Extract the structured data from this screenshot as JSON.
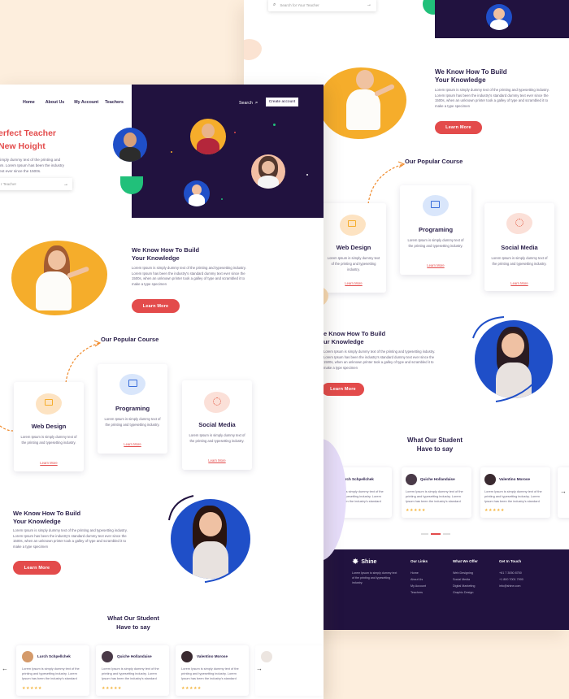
{
  "colors": {
    "navy": "#21123f",
    "accent_red": "#e34b4b",
    "accent_yellow": "#f5ad2b",
    "blue": "#1f4fc8",
    "green": "#21c07a",
    "peach_bg": "#fdeedd"
  },
  "back": {
    "search_placeholder": "Search for Your Teacher",
    "know_title_1": "We Know How To Build",
    "know_title_2": "Your Knowledge",
    "know_text": "Lorem Ipsum is simply dummy text of the printing and typesetting industry. Lorem Ipsum has been the industry's standard dummy text ever since the 1500s, when an unknown printer took a galley of type and scrambled it to make a type specimen",
    "learn_more": "Learn More",
    "popular_course": "Our Popular Course",
    "courses": [
      {
        "title": "Web Design",
        "desc": "Lorem Ipsum is simply dummy text of the printing and typesetting industry.",
        "link": "Learn More"
      },
      {
        "title": "Programing",
        "desc": "Lorem Ipsum is simply dummy text of the printing and typesetting industry.",
        "link": "Learn More"
      },
      {
        "title": "Social Media",
        "desc": "Lorem Ipsum is simply dummy text of the printing and typesetting industry.",
        "link": "Learn More"
      }
    ],
    "know2_title_1": "e Know How To Build",
    "know2_title_2": "ur Knowledge",
    "know2_text": "Lorem Ipsum is simply dummy text of the printing and typesetting industry. Lorem Ipsum has been the industry's standard dummy text ever since the 1500s, when an unknown printer took a galley of type and scrambled it to make a type specimen",
    "learn_more_2": "Learn More",
    "student_title_1": "What Our Student",
    "student_title_2": "Have to say",
    "testimonials": [
      {
        "name": "Lurch Schpellchek",
        "text": "Lorem Ipsum is simply dummy text of the printing and typesetting industry. Lorem Ipsum has been the industry's standard",
        "stars": "★★★★★"
      },
      {
        "name": "Quiche Hollandaise",
        "text": "Lorem Ipsum is simply dummy text of the printing and typesetting industry. Lorem Ipsum has been the industry's standard",
        "stars": "★★★★★"
      },
      {
        "name": "Valentino Morose",
        "text": "Lorem Ipsum is simply dummy text of the printing and typesetting industry. Lorem Ipsum has been the industry's standard",
        "stars": "★★★★★"
      }
    ],
    "footer": {
      "brand": "Shine",
      "brand_text": "Lorem Ipsum is simply dummy text of the printing and typesetting industry.",
      "col1_title": "Our Links",
      "col1_items": [
        "Home",
        "About Us",
        "My Account",
        "Teachers"
      ],
      "col2_title": "What We Offer",
      "col2_items": [
        "Web Designing",
        "Social Media",
        "Digital Marketing",
        "Graphic Design"
      ],
      "col3_title": "Get In Touch",
      "col3_items": [
        "+61 7 3050 8750",
        "+1 800 7001 7900",
        "info@shine.com"
      ]
    }
  },
  "front": {
    "nav": [
      "Home",
      "About Us",
      "My Account",
      "Teachers"
    ],
    "search_label": "Search",
    "create_account": "Create account",
    "hero_title_1": "erfect Teacher",
    "hero_title_2": "New Hoight",
    "hero_text": "simply dummy text of the printing and um. Lorem Ipsum has been the industry text ever since the 1500s.",
    "search_placeholder": "r Teacher",
    "know_title_1": "We Know How To Build",
    "know_title_2": "Your Knowledge",
    "know_text": "Lorem Ipsum is simply dummy text of the printing and typesetting industry. Lorem Ipsum has been the industry's standard dummy text ever since the 1500s, when an unknown printer took a galley of type and scrambled it to make a type specimen",
    "learn_more": "Learn More",
    "popular_course": "Our Popular Course",
    "courses": [
      {
        "title": "Web Design",
        "desc": "Lorem Ipsum is simply dummy text of the printing and typesetting industry.",
        "link": "Learn More"
      },
      {
        "title": "Programing",
        "desc": "Lorem Ipsum is simply dummy text of the printing and typesetting industry.",
        "link": "Learn More"
      },
      {
        "title": "Social Media",
        "desc": "Lorem Ipsum is simply dummy text of the printing and typesetting industry.",
        "link": "Learn More"
      }
    ],
    "know2_title_1": "We Know How To Build",
    "know2_title_2": "Your Knowledge",
    "know2_text": "Lorem Ipsum is simply dummy text of the printing and typesetting industry. Lorem Ipsum has been the industry's standard dummy text ever since the 1500s, when an unknown printer took a galley of type and scrambled it to make a type specimen",
    "learn_more_2": "Learn More",
    "student_title_1": "What Our Student",
    "student_title_2": "Have to say",
    "testimonials": [
      {
        "name": "Lurch Schpellchek",
        "text": "Lorem Ipsum is simply dummy text of the printing and typesetting industry. Lorem Ipsum has been the industry's standard",
        "stars": "★★★★★"
      },
      {
        "name": "Quiche Hollandaise",
        "text": "Lorem Ipsum is simply dummy text of the printing and typesetting industry. Lorem Ipsum has been the industry's standard",
        "stars": "★★★★★"
      },
      {
        "name": "Valentino Morose",
        "text": "Lorem Ipsum is simply dummy text of the printing and typesetting industry. Lorem Ipsum has been the industry's standard",
        "stars": "★★★★★"
      }
    ]
  }
}
